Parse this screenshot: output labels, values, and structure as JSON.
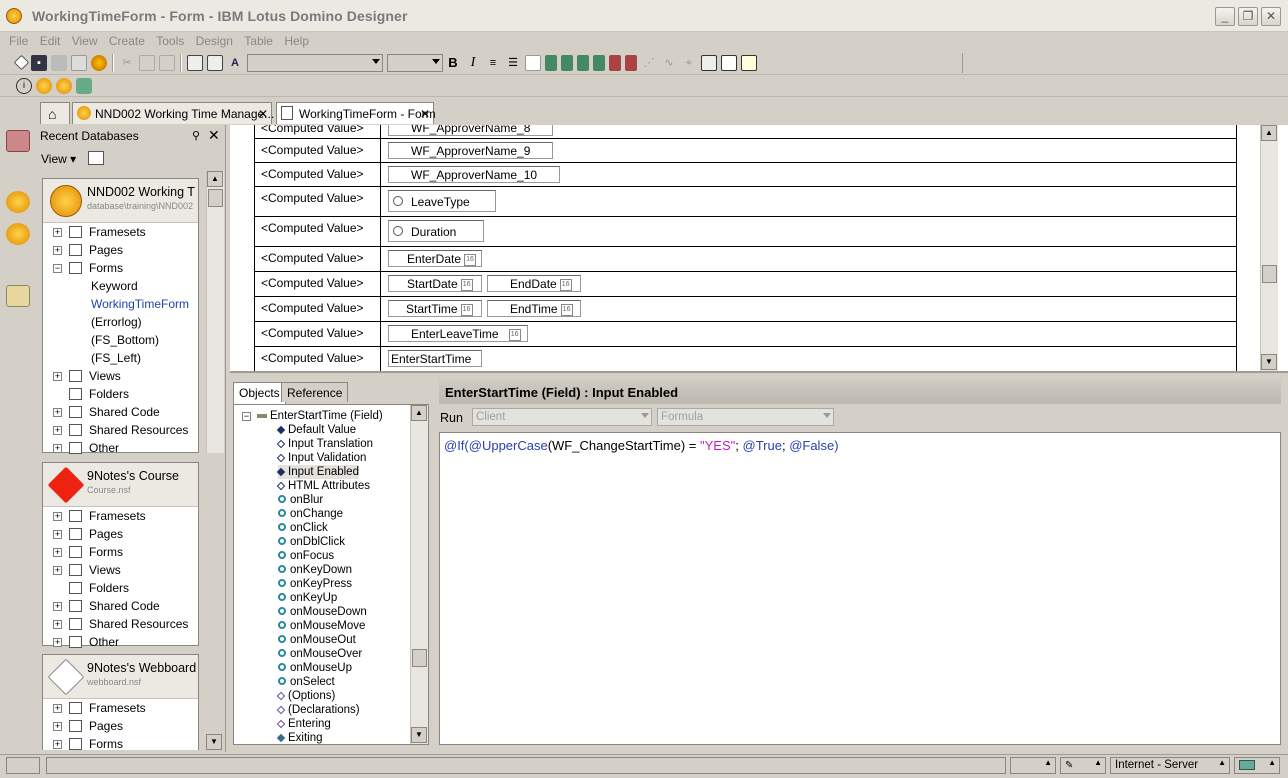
{
  "window": {
    "title": "WorkingTimeForm - Form - IBM Lotus Domino Designer"
  },
  "menu": [
    "File",
    "Edit",
    "View",
    "Create",
    "Tools",
    "Design",
    "Table",
    "Help"
  ],
  "tabs": [
    {
      "label": "NND002 Working Time Manage..."
    },
    {
      "label": "WorkingTimeForm - Form"
    }
  ],
  "bookmarks": {
    "header": "Recent Databases",
    "view_label": "View",
    "dbs": [
      {
        "title": "NND002 Working T",
        "path": "database\\training\\NND002",
        "items": [
          "Framesets",
          "Pages",
          "Forms",
          "Keyword",
          "WorkingTimeForm",
          "(Errorlog)",
          "(FS_Bottom)",
          "(FS_Left)",
          "Views",
          "Folders",
          "Shared Code",
          "Shared Resources",
          "Other"
        ]
      },
      {
        "title": "9Notes's Course",
        "path": "Course.nsf",
        "logo": "9NOTES",
        "items": [
          "Framesets",
          "Pages",
          "Forms",
          "Views",
          "Folders",
          "Shared Code",
          "Shared Resources",
          "Other"
        ]
      },
      {
        "title": "9Notes's Webboard",
        "path": "webboard.nsf",
        "logo": "9NOTES",
        "items": [
          "Framesets",
          "Pages",
          "Forms"
        ]
      }
    ]
  },
  "form": {
    "computed": "<Computed Value>",
    "fields": {
      "appr8": "WF_ApproverName_8",
      "appr9": "WF_ApproverName_9",
      "appr10": "WF_ApproverName_10",
      "leavetype": "LeaveType",
      "duration": "Duration",
      "enterdate": "EnterDate",
      "startdate": "StartDate",
      "enddate": "EndDate",
      "starttime": "StartTime",
      "endtime": "EndTime",
      "enterleavetime": "EnterLeaveTime",
      "enterstarttime": "EnterStartTime"
    },
    "date_icon": "16"
  },
  "objects": {
    "tab_objects": "Objects",
    "tab_reference": "Reference",
    "root": "EnterStartTime (Field)",
    "items": [
      "Default Value",
      "Input Translation",
      "Input Validation",
      "Input Enabled",
      "HTML Attributes",
      "onBlur",
      "onChange",
      "onClick",
      "onDblClick",
      "onFocus",
      "onKeyDown",
      "onKeyPress",
      "onKeyUp",
      "onMouseDown",
      "onMouseMove",
      "onMouseOut",
      "onMouseOver",
      "onMouseUp",
      "onSelect",
      "(Options)",
      "(Declarations)",
      "Entering",
      "Exiting"
    ]
  },
  "editor": {
    "title": "EnterStartTime (Field) : Input Enabled",
    "run_label": "Run",
    "run_client": "Client",
    "run_formula": "Formula",
    "code": {
      "p1": "@If(",
      "p2": "@UpperCase",
      "p3": "(WF_ChangeStartTime) = ",
      "p4": "\"YES\"",
      "p5": "; ",
      "p6": "@True",
      "p7": "; ",
      "p8": "@False",
      "p9": ")"
    }
  },
  "status": {
    "server": "Internet - Server"
  }
}
